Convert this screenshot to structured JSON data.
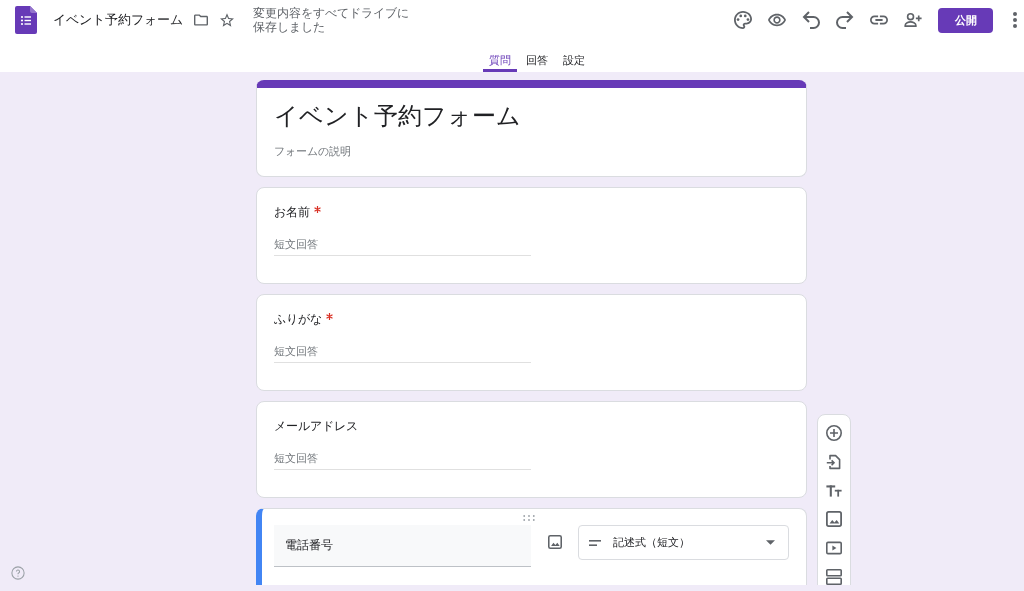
{
  "header": {
    "doc_title": "イベント予約フォーム",
    "save_status": "変更内容をすべてドライブに保存しました",
    "publish_button": "公開"
  },
  "tabs": [
    {
      "label": "質問",
      "selected": true
    },
    {
      "label": "回答",
      "selected": false
    },
    {
      "label": "設定",
      "selected": false
    }
  ],
  "form": {
    "title": "イベント予約フォーム",
    "description": "フォームの説明"
  },
  "questions": [
    {
      "title": "お名前",
      "required": true,
      "answer_hint": "短文回答",
      "selected": false
    },
    {
      "title": "ふりがな",
      "required": true,
      "answer_hint": "短文回答",
      "selected": false
    },
    {
      "title": "メールアドレス",
      "required": false,
      "answer_hint": "短文回答",
      "selected": false
    },
    {
      "title": "電話番号",
      "required": false,
      "selected": true,
      "type": "記述式（短文）"
    }
  ]
}
